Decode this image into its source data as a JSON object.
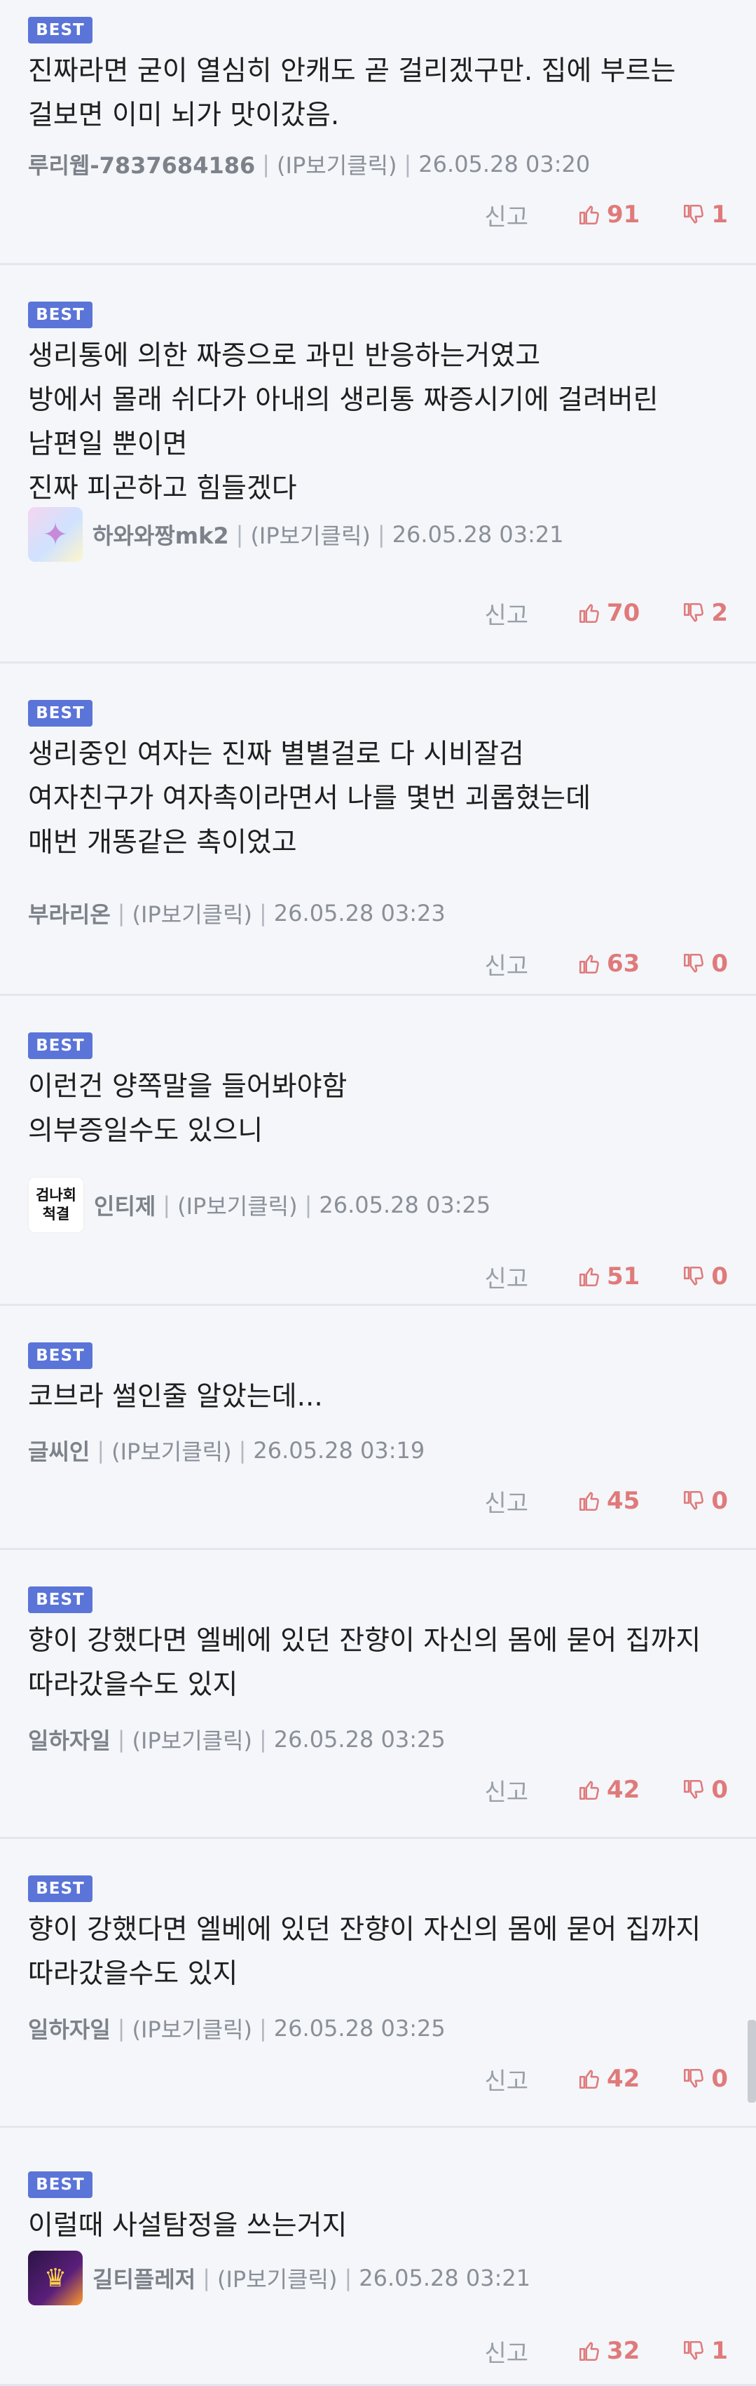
{
  "labels": {
    "best": "BEST",
    "ip": "(IP보기클릭)",
    "report": "신고",
    "sep": "|"
  },
  "colors": {
    "badge": "#5a74d8",
    "vote": "#e07a7a",
    "background": "#f4f6fa"
  },
  "comments": [
    {
      "text": "진짜라면 굳이 열심히 안캐도 곧 걸리겠구만. 집에 부르는 걸보면 이미 뇌가 맛이갔음.",
      "author": "루리웹-7837684186",
      "time": "26.05.28 03:20",
      "up": "91",
      "down": "1",
      "avatar": ""
    },
    {
      "text": "생리통에 의한 짜증으로 과민 반응하는거였고\n방에서 몰래 쉬다가 아내의 생리통 짜증시기에 걸려버린 남편일 뿐이면\n진짜 피곤하고 힘들겠다",
      "author": "하와와짱mk2",
      "time": "26.05.28 03:21",
      "up": "70",
      "down": "2",
      "avatar": "sparkle"
    },
    {
      "text": "생리중인 여자는 진짜 별별걸로 다 시비잘검\n여자친구가 여자촉이라면서 나를 몇번 괴롭혔는데\n매번 개똥같은 촉이었고",
      "author": "부라리온",
      "time": "26.05.28 03:23",
      "up": "63",
      "down": "0",
      "avatar": ""
    },
    {
      "text": "이런건 양쪽말을 들어봐야함\n의부증일수도 있으니",
      "author": "인티제",
      "time": "26.05.28 03:25",
      "up": "51",
      "down": "0",
      "avatar": "text",
      "avatar_text": [
        "검나회",
        "척결"
      ]
    },
    {
      "text": "코브라 썰인줄 알았는데...",
      "author": "글씨인",
      "time": "26.05.28 03:19",
      "up": "45",
      "down": "0",
      "avatar": ""
    },
    {
      "text": "향이 강했다면 엘베에 있던 잔향이 자신의 몸에 묻어 집까지 따라갔을수도 있지",
      "author": "일하자일",
      "time": "26.05.28 03:25",
      "up": "42",
      "down": "0",
      "avatar": ""
    },
    {
      "text": "향이 강했다면 엘베에 있던 잔향이 자신의 몸에 묻어 집까지 따라갔을수도 있지",
      "author": "일하자일",
      "time": "26.05.28 03:25",
      "up": "42",
      "down": "0",
      "avatar": ""
    },
    {
      "text": "이럴때 사설탐정을 쓰는거지",
      "author": "길티플레저",
      "time": "26.05.28 03:21",
      "up": "32",
      "down": "1",
      "avatar": "dark"
    }
  ]
}
